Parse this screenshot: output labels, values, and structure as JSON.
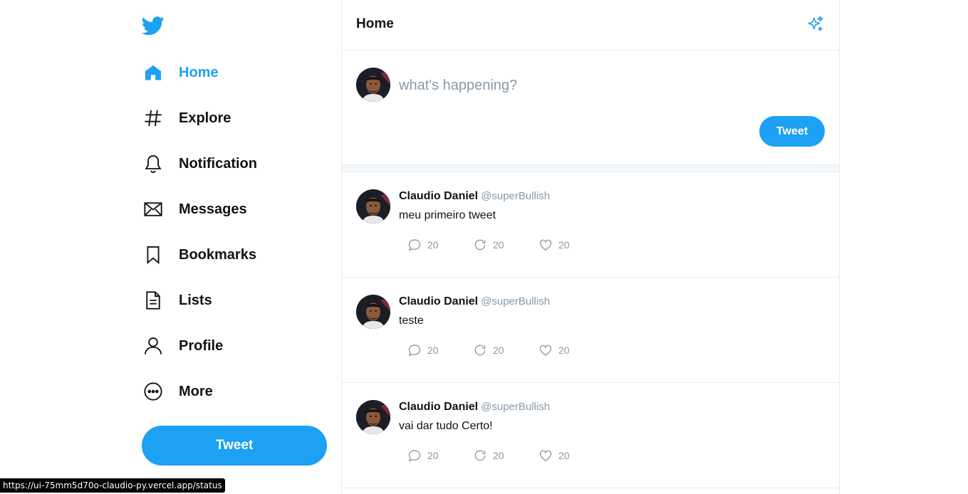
{
  "sidebar": {
    "logo": "twitter-bird-icon",
    "items": [
      {
        "label": "Home",
        "icon": "home-icon",
        "active": true
      },
      {
        "label": "Explore",
        "icon": "hashtag-icon"
      },
      {
        "label": "Notification",
        "icon": "bell-icon"
      },
      {
        "label": "Messages",
        "icon": "envelope-icon"
      },
      {
        "label": "Bookmarks",
        "icon": "bookmark-icon"
      },
      {
        "label": "Lists",
        "icon": "list-icon"
      },
      {
        "label": "Profile",
        "icon": "user-icon"
      },
      {
        "label": "More",
        "icon": "more-circle-icon"
      }
    ],
    "tweet_button": "Tweet"
  },
  "header": {
    "title": "Home",
    "icon": "sparkle-icon"
  },
  "composer": {
    "placeholder": "what's happening?",
    "tweet_button": "Tweet"
  },
  "tweets": [
    {
      "name": "Claudio Daniel",
      "handle": "@superBullish",
      "text": "meu primeiro tweet",
      "replies": "20",
      "retweets": "20",
      "likes": "20"
    },
    {
      "name": "Claudio Daniel",
      "handle": "@superBullish",
      "text": "teste",
      "replies": "20",
      "retweets": "20",
      "likes": "20"
    },
    {
      "name": "Claudio Daniel",
      "handle": "@superBullish",
      "text": "vai dar tudo Certo!",
      "replies": "20",
      "retweets": "20",
      "likes": "20"
    }
  ],
  "status_bar": {
    "url": "https://ui-75mm5d70o-claudio-py.vercel.app/status"
  },
  "colors": {
    "accent": "#1da1f2",
    "text": "#0f1419",
    "muted": "#8899a6",
    "border": "#e6ecf0"
  }
}
